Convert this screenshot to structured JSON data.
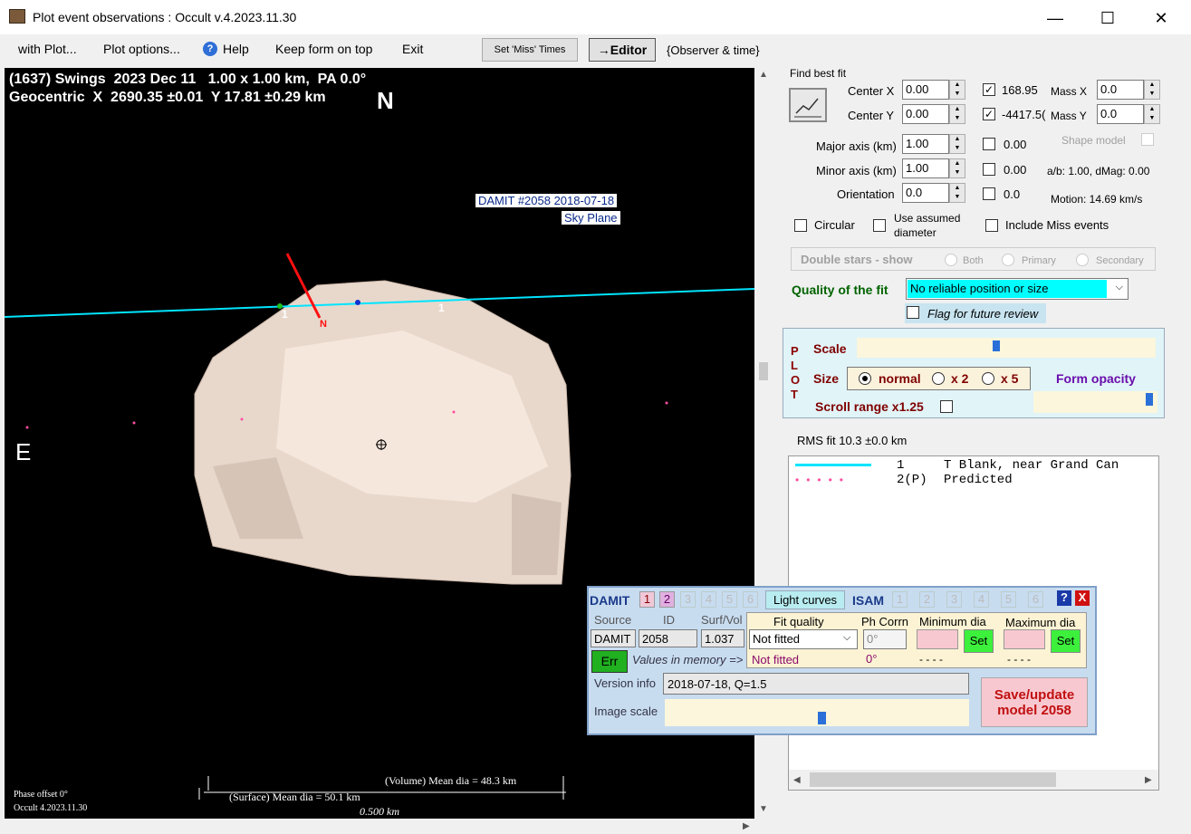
{
  "window": {
    "title": "Plot event observations : Occult v.4.2023.11.30",
    "min": "—",
    "max": "☐",
    "close": "✕"
  },
  "menu": {
    "with_plot": "with Plot...",
    "plot_options": "Plot options...",
    "help": "Help",
    "keep_form": "Keep form on top",
    "exit": "Exit"
  },
  "toolbar": {
    "set_miss": "Set 'Miss' Times",
    "editor": "→Editor",
    "observer_time": "{Observer & time}"
  },
  "plot": {
    "header1": "(1637) Swings  2023 Dec 11   1.00 x 1.00 km,  PA 0.0°",
    "header2": "Geocentric  X  2690.35 ±0.01  Y 17.81 ±0.29 km",
    "north": "N",
    "east": "E",
    "damit_label": "DAMIT #2058 2018-07-18",
    "sky_plane": "Sky Plane",
    "chord1": "1",
    "chord2": "1",
    "pole": "N",
    "volume_dia": "(Volume) Mean dia = 48.3 km",
    "surface_dia": "(Surface) Mean dia = 50.1 km",
    "scale_bar": "0.500 km",
    "phase_offset": "Phase offset 0°",
    "occult_version": "Occult 4.2023.11.30"
  },
  "fit": {
    "find_best_fit": "Find best fit",
    "center_x_label": "Center X",
    "center_x": "0.00",
    "center_x_val": "168.95",
    "center_y_label": "Center Y",
    "center_y": "0.00",
    "center_y_val": "-4417.5(",
    "mass_x_label": "Mass X",
    "mass_x": "0.0",
    "mass_y_label": "Mass Y",
    "mass_y": "0.0",
    "major_label": "Major axis (km)",
    "major": "1.00",
    "major_val": "0.00",
    "minor_label": "Minor axis (km)",
    "minor": "1.00",
    "minor_val": "0.00",
    "orient_label": "Orientation",
    "orient": "0.0",
    "orient_val": "0.0",
    "shape_model": "Shape model",
    "ab_dmag": "a/b: 1.00, dMag: 0.00",
    "motion": "Motion: 14.69 km/s",
    "circular": "Circular",
    "use_assumed": "Use assumed",
    "diameter": "diameter",
    "include_miss": "Include Miss events",
    "double_stars": "Double stars - show",
    "both": "Both",
    "primary": "Primary",
    "secondary": "Secondary",
    "quality_label": "Quality of the fit",
    "quality_value": "No reliable position or size",
    "flag_review": "Flag for future review"
  },
  "plotbox": {
    "letters": "P\nL\nO\nT",
    "scale": "Scale",
    "size": "Size",
    "normal": "normal",
    "x2": "x 2",
    "x5": "x 5",
    "form_opacity": "Form opacity",
    "scroll_range": "Scroll range x1.25"
  },
  "rms": "RMS fit 10.3 ±0.0 km",
  "legend": [
    {
      "num": "1",
      "text": "T Blank, near Grand Can",
      "color": "#00e5ff",
      "style": "line"
    },
    {
      "num": "2(P)",
      "text": "Predicted",
      "color": "#ff4fa0",
      "style": "dots"
    }
  ],
  "damit": {
    "title": "DAMIT",
    "nums": [
      "1",
      "2",
      "3",
      "4",
      "5",
      "6"
    ],
    "light_curves": "Light curves",
    "isam": "ISAM",
    "isam_nums": [
      "1",
      "2",
      "3",
      "4",
      "5",
      "6"
    ],
    "help": "?",
    "close": "X",
    "source_h": "Source",
    "id_h": "ID",
    "surfvol_h": "Surf/Vol",
    "source": "DAMIT",
    "id": "2058",
    "surfvol": "1.037",
    "fit_quality_h": "Fit quality",
    "phcorr_h": "Ph Corrn",
    "min_dia_h": "Minimum dia",
    "max_dia_h": "Maximum dia",
    "fit_quality": "Not fitted",
    "phcorr": "0°",
    "set": "Set",
    "err": "Err",
    "values_memory": "Values in memory =>",
    "mem_fit": "Not fitted",
    "mem_ph": "0°",
    "mem_min": "- - - -",
    "mem_max": "- - - -",
    "version_label": "Version info",
    "version": "2018-07-18, Q=1.5",
    "image_scale": "Image scale",
    "save": "Save/update",
    "save2": "model 2058"
  }
}
